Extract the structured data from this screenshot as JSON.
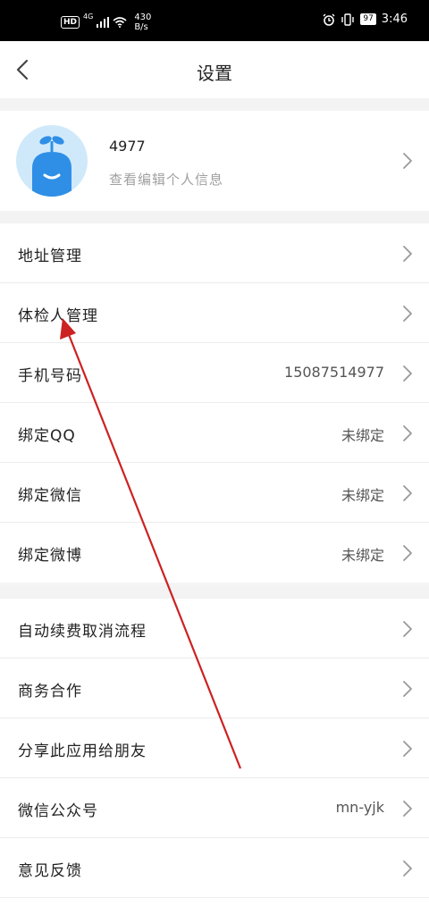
{
  "status_bar": {
    "hd": "HD",
    "network": "4G",
    "speed_value": "430",
    "speed_unit": "B/s",
    "battery": "97",
    "time": "3:46"
  },
  "nav": {
    "title": "设置",
    "back_icon": "chevron-left-icon"
  },
  "profile": {
    "username": "4977",
    "subtitle": "查看编辑个人信息"
  },
  "groups": [
    {
      "items": [
        {
          "label": "地址管理",
          "value": ""
        },
        {
          "label": "体检人管理",
          "value": ""
        },
        {
          "label": "手机号码",
          "value": "15087514977"
        },
        {
          "label": "绑定QQ",
          "value": "未绑定"
        },
        {
          "label": "绑定微信",
          "value": "未绑定"
        },
        {
          "label": "绑定微博",
          "value": "未绑定"
        }
      ]
    },
    {
      "items": [
        {
          "label": "自动续费取消流程",
          "value": ""
        },
        {
          "label": "商务合作",
          "value": ""
        },
        {
          "label": "分享此应用给朋友",
          "value": ""
        },
        {
          "label": "微信公众号",
          "value": "mn-yjk"
        },
        {
          "label": "意见反馈",
          "value": ""
        }
      ]
    }
  ],
  "colors": {
    "annotation_arrow": "#cc2222",
    "avatar_bg": "#cfe9fb",
    "avatar_figure": "#2f8fe6"
  }
}
